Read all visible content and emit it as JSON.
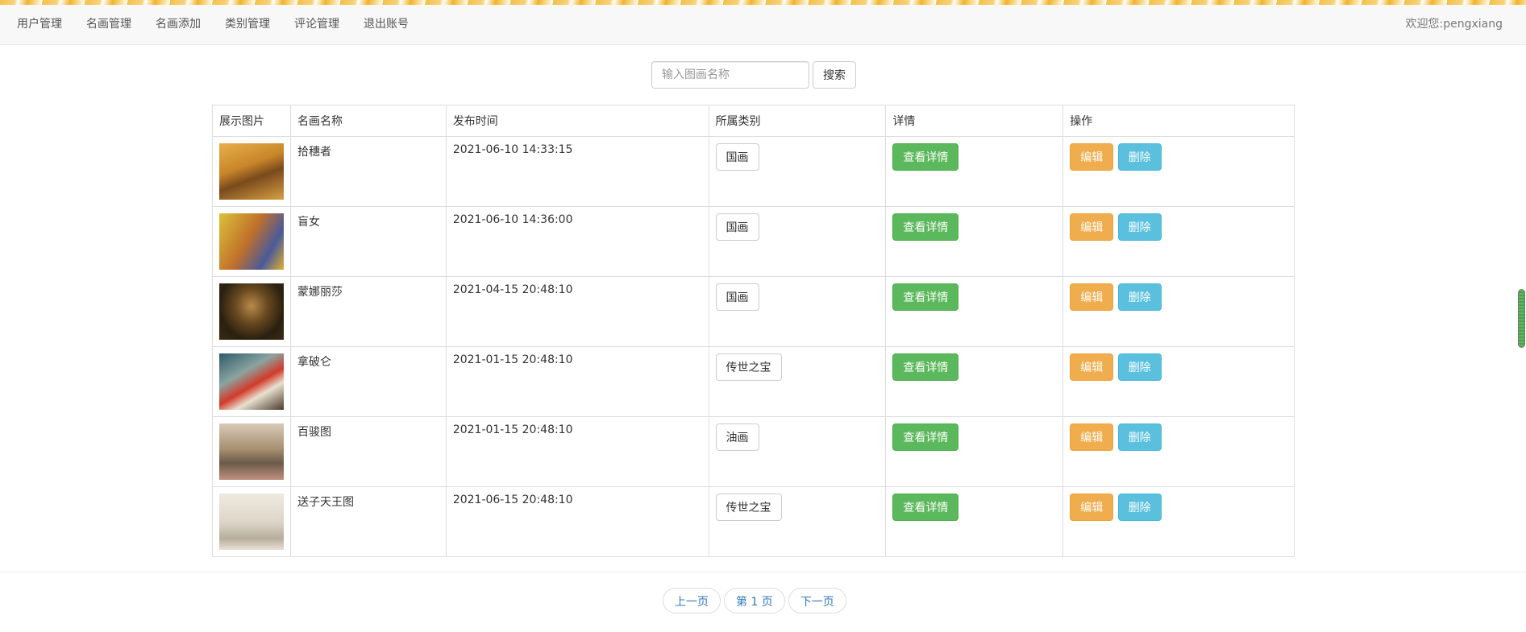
{
  "nav": {
    "items": [
      {
        "label": "用户管理"
      },
      {
        "label": "名画管理"
      },
      {
        "label": "名画添加"
      },
      {
        "label": "类别管理"
      },
      {
        "label": "评论管理"
      },
      {
        "label": "退出账号"
      }
    ],
    "welcome": "欢迎您:pengxiang"
  },
  "search": {
    "placeholder": "输入图画名称",
    "value": "",
    "button_label": "搜索"
  },
  "table": {
    "headers": [
      "展示图片",
      "名画名称",
      "发布时间",
      "所属类别",
      "详情",
      "操作"
    ],
    "rows": [
      {
        "name": "拾穗者",
        "time": "2021-06-10 14:33:15",
        "category": "国画",
        "detail_label": "查看详情",
        "edit_label": "编辑",
        "delete_label": "删除"
      },
      {
        "name": "盲女",
        "time": "2021-06-10 14:36:00",
        "category": "国画",
        "detail_label": "查看详情",
        "edit_label": "编辑",
        "delete_label": "删除"
      },
      {
        "name": "蒙娜丽莎",
        "time": "2021-04-15 20:48:10",
        "category": "国画",
        "detail_label": "查看详情",
        "edit_label": "编辑",
        "delete_label": "删除"
      },
      {
        "name": "拿破仑",
        "time": "2021-01-15 20:48:10",
        "category": "传世之宝",
        "detail_label": "查看详情",
        "edit_label": "编辑",
        "delete_label": "删除"
      },
      {
        "name": "百骏图",
        "time": "2021-01-15 20:48:10",
        "category": "油画",
        "detail_label": "查看详情",
        "edit_label": "编辑",
        "delete_label": "删除"
      },
      {
        "name": "送子天王图",
        "time": "2021-06-15 20:48:10",
        "category": "传世之宝",
        "detail_label": "查看详情",
        "edit_label": "编辑",
        "delete_label": "删除"
      }
    ]
  },
  "pager": {
    "prev_label": "上一页",
    "current_label": "第 1 页",
    "next_label": "下一页"
  },
  "colors": {
    "success": "#5cb85c",
    "warning": "#f0ad4e",
    "info": "#5bc0de",
    "link": "#337ab7"
  }
}
